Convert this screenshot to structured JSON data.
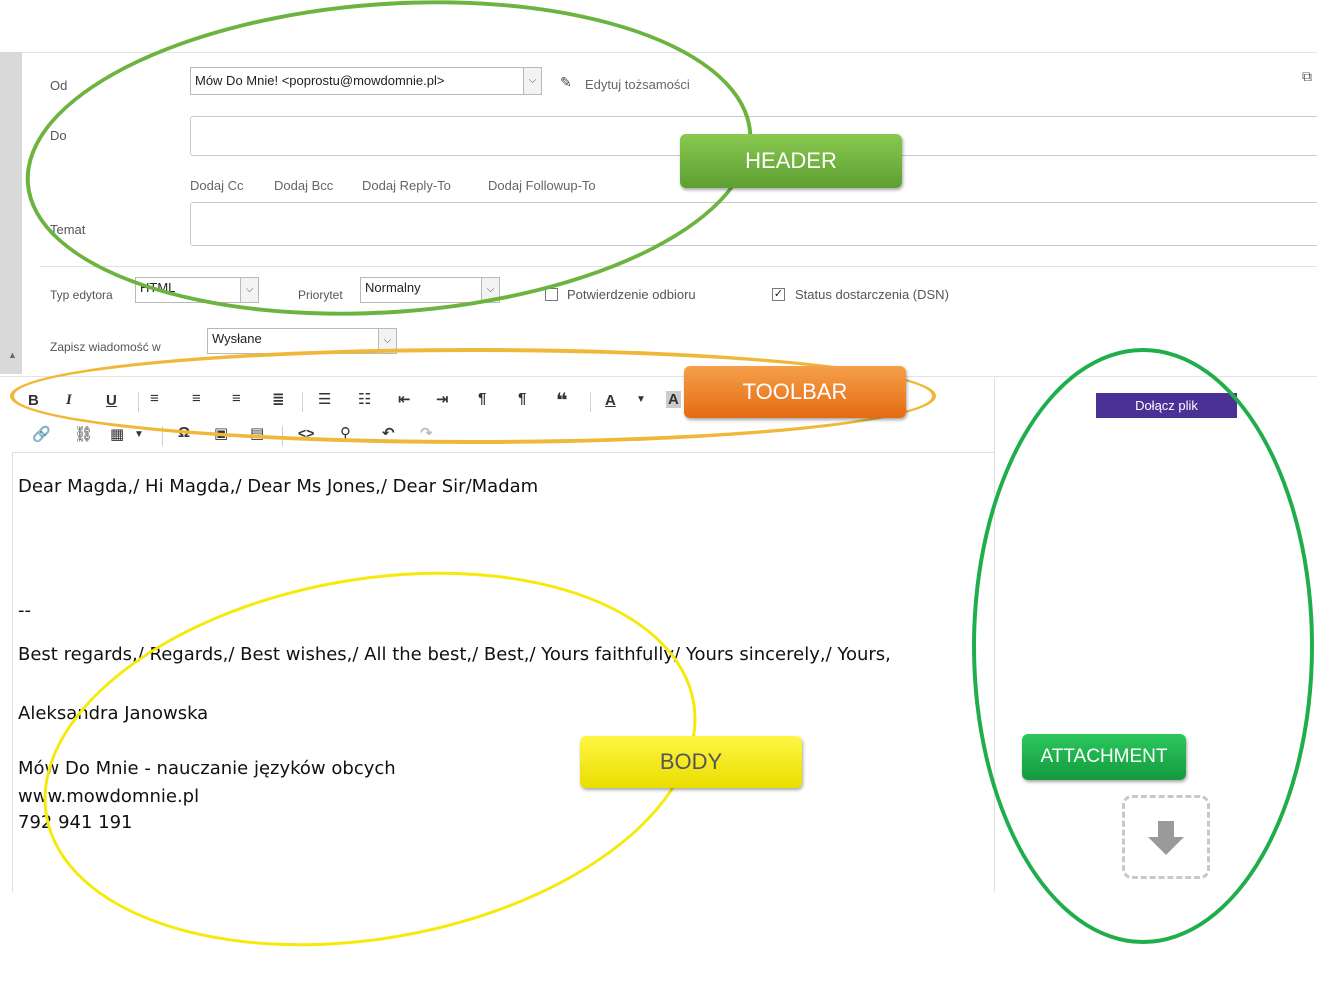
{
  "header": {
    "from_label": "Od",
    "from_value": "Mów Do Mnie! <poprostu@mowdomnie.pl>",
    "edit_identities": "Edytuj tożsamości",
    "to_label": "Do",
    "to_value": "",
    "add_cc": "Dodaj Cc",
    "add_bcc": "Dodaj Bcc",
    "add_reply_to": "Dodaj Reply-To",
    "add_followup_to": "Dodaj Followup-To",
    "subject_label": "Temat",
    "subject_value": ""
  },
  "options": {
    "editor_type_label": "Typ edytora",
    "editor_type_value": "HTML",
    "priority_label": "Priorytet",
    "priority_value": "Normalny",
    "read_receipt_label": "Potwierdzenie odbioru",
    "read_receipt_checked": false,
    "dsn_label": "Status dostarczenia (DSN)",
    "dsn_checked": true,
    "save_in_label": "Zapisz wiadomość w",
    "save_in_value": "Wysłane"
  },
  "toolbar": {
    "row1": [
      "B",
      "I",
      "U",
      "align-left",
      "align-center",
      "align-right",
      "align-justify",
      "bullet-list",
      "numbered-list",
      "outdent",
      "indent",
      "ltr",
      "rtl",
      "quote",
      "text-color",
      "text-color-dropdown",
      "background-color"
    ],
    "row2": [
      "link",
      "unlink",
      "table",
      "table-dropdown",
      "special-char",
      "image",
      "media",
      "source-code",
      "find-replace",
      "undo",
      "redo"
    ]
  },
  "attachment": {
    "attach_button": "Dołącz plik"
  },
  "body": {
    "greeting": "Dear Magda,/ Hi Magda,/ Dear Ms Jones,/ Dear Sir/Madam",
    "separator": "--",
    "closing": "Best regards,/ Regards,/ Best wishes,/ All the best,/ Best,/ Yours faithfully/ Yours sincerely,/ Yours,",
    "name": "Aleksandra Janowska",
    "company": "Mów Do Mnie - nauczanie języków obcych",
    "website": "www.mowdomnie.pl",
    "phone": "792 941 191"
  },
  "annotations": {
    "header_badge": "HEADER",
    "toolbar_badge": "TOOLBAR",
    "body_badge": "BODY",
    "attachment_badge": "ATTACHMENT",
    "colors": {
      "header": "#6cb33f",
      "toolbar": "#f07c1d",
      "body": "#f5ea0a",
      "attachment": "#1fae4b",
      "attach_button": "#4b3196"
    }
  }
}
